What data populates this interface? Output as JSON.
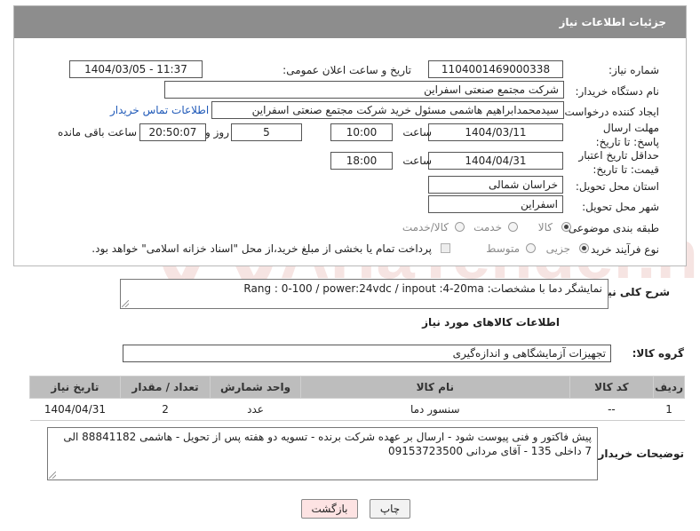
{
  "header": {
    "title": "جزئیات اطلاعات نیاز"
  },
  "form": {
    "need_number_label": "شماره نیاز:",
    "need_number": "1104001469000338",
    "announce_label": "تاریخ و ساعت اعلان عمومی:",
    "announce_value": "1404/03/05 - 11:37",
    "buyer_org_label": "نام دستگاه خریدار:",
    "buyer_org": "شرکت مجتمع صنعتی اسفراین",
    "creator_label": "ایجاد کننده درخواست:",
    "creator": "سیدمحمدابراهیم هاشمی مسئول خرید شرکت مجتمع صنعتی اسفراین",
    "contact_link": "اطلاعات تماس خریدار",
    "deadline_label": "مهلت ارسال پاسخ: تا تاریخ:",
    "deadline_date": "1404/03/11",
    "time_label": "ساعت",
    "deadline_time": "10:00",
    "days_value": "5",
    "days_label": "روز و",
    "remaining_time": "20:50:07",
    "remaining_label": "ساعت باقی مانده",
    "validity_label": "حداقل تاریخ اعتبار قیمت: تا تاریخ:",
    "validity_date": "1404/04/31",
    "validity_time_label": "ساعت",
    "validity_time": "18:00",
    "province_label": "استان محل تحویل:",
    "province": "خراسان شمالی",
    "city_label": "شهر محل تحویل:",
    "city": "اسفراین",
    "category_label": "طبقه بندی موضوعی:",
    "category_options": [
      "کالا",
      "خدمت",
      "کالا/خدمت"
    ],
    "process_label": "نوع فرآیند خرید :",
    "process_options": [
      "جزیی",
      "متوسط"
    ],
    "payment_note": "پرداخت تمام یا بخشی از مبلغ خرید،از محل \"اسناد خزانه اسلامی\" خواهد بود."
  },
  "summary": {
    "label": "شرح کلی نیاز:",
    "text": "نمایشگر دما با مشخصات: Rang : 0-100 / power:24vdc / inpout :4-20ma"
  },
  "goods": {
    "section_title": "اطلاعات کالاهای مورد نیاز",
    "group_label": "گروه کالا:",
    "group_value": "تجهیزات آزمایشگاهی و اندازه‌گیری",
    "columns": [
      "ردیف",
      "کد کالا",
      "نام کالا",
      "واحد شمارش",
      "تعداد / مقدار",
      "تاریخ نیاز"
    ],
    "rows": [
      {
        "row": "1",
        "code": "--",
        "name": "سنسور دما",
        "unit": "عدد",
        "qty": "2",
        "date": "1404/04/31"
      }
    ]
  },
  "buyer_notes": {
    "label": "توضیحات خریدار:",
    "text": "پیش فاکتور و فنی پیوست شود - ارسال بر عهده شرکت برنده - تسویه دو هفته پس از تحویل - هاشمی 88841182 الی 7 داخلی 135 - آقای مردانی 09153723500"
  },
  "buttons": {
    "print": "چاپ",
    "back": "بازگشت"
  },
  "watermark": {
    "text": "AriaTender.neT"
  },
  "colors": {
    "header_bg": "#8d8d8d",
    "link": "#1f59b8",
    "back_btn_bg": "#fde3e3"
  }
}
